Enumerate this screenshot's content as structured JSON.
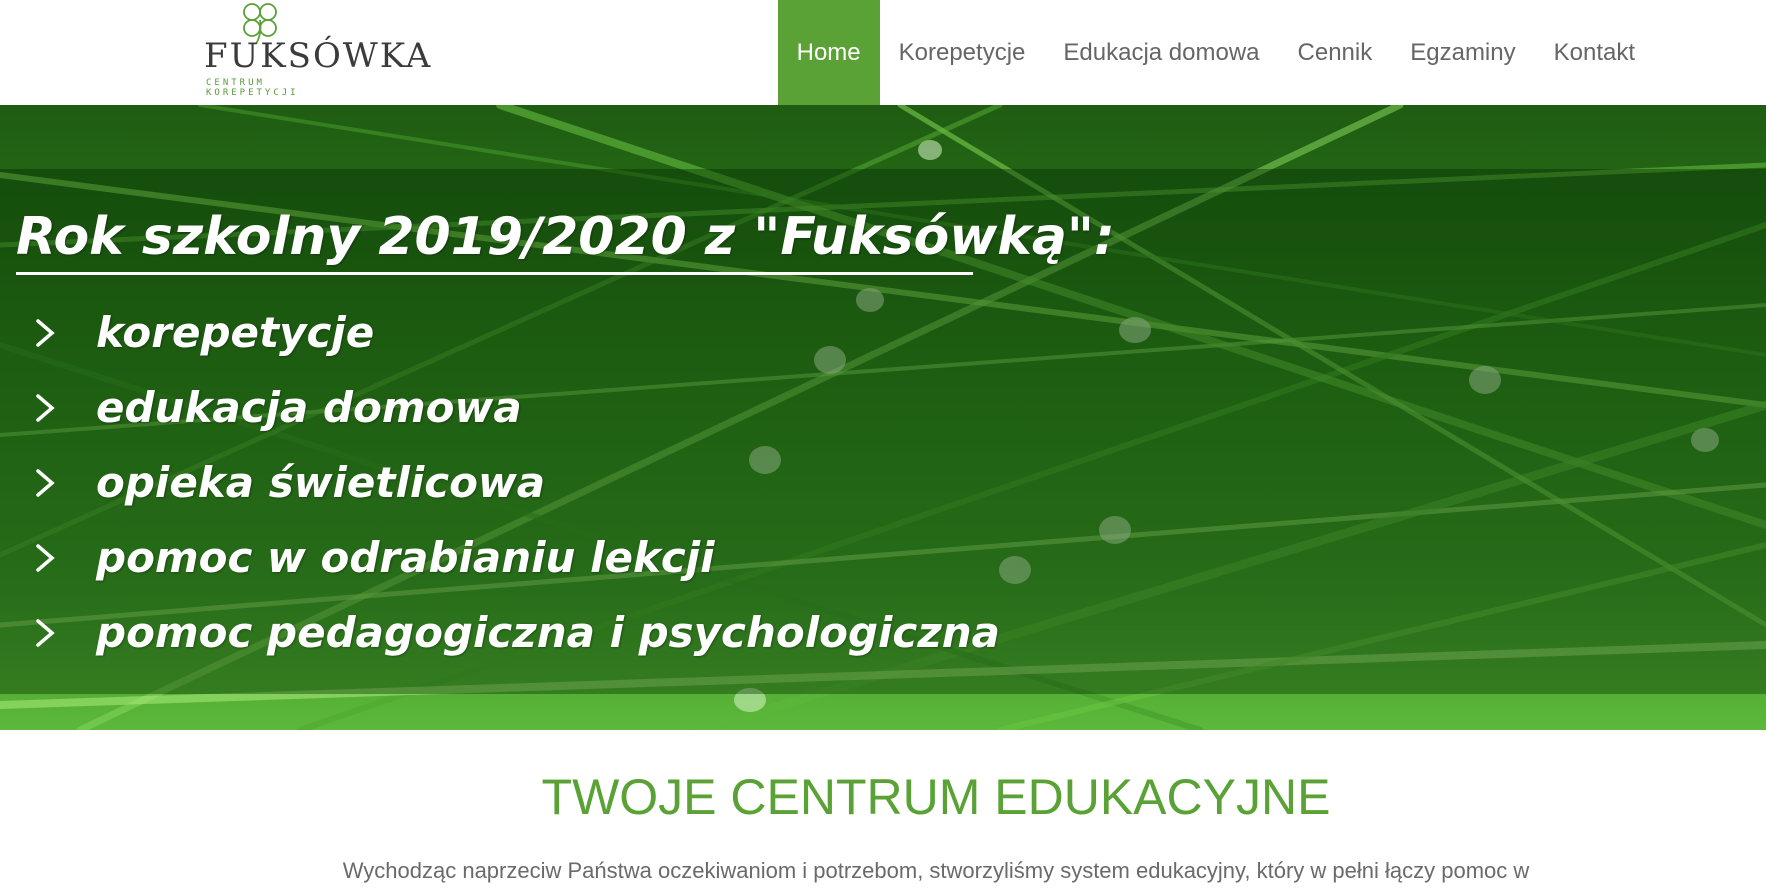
{
  "logo": {
    "name": "FUKSÓWKA",
    "subtitle": "CENTRUM KOREPETYCJI"
  },
  "nav": {
    "items": [
      {
        "label": "Home",
        "active": true
      },
      {
        "label": "Korepetycje",
        "active": false
      },
      {
        "label": "Edukacja domowa",
        "active": false
      },
      {
        "label": "Cennik",
        "active": false
      },
      {
        "label": "Egzaminy",
        "active": false
      },
      {
        "label": "Kontakt",
        "active": false
      }
    ]
  },
  "hero": {
    "title": "Rok szkolny 2019/2020 z \"Fuksówką\":",
    "items": [
      "korepetycje",
      "edukacja domowa",
      "opieka świetlicowa",
      "pomoc w odrabianiu lekcji",
      "pomoc pedagogiczna i psychologiczna"
    ]
  },
  "main": {
    "heading": "TWOJE CENTRUM EDUKACYJNE",
    "intro": "Wychodząc naprzeciw Państwa oczekiwaniom i potrzebom, stworzyliśmy system edukacyjny, który w pełni łączy pomoc w"
  },
  "colors": {
    "accent": "#5aa136",
    "nav_text": "#666666",
    "hero_text": "#ffffff"
  }
}
